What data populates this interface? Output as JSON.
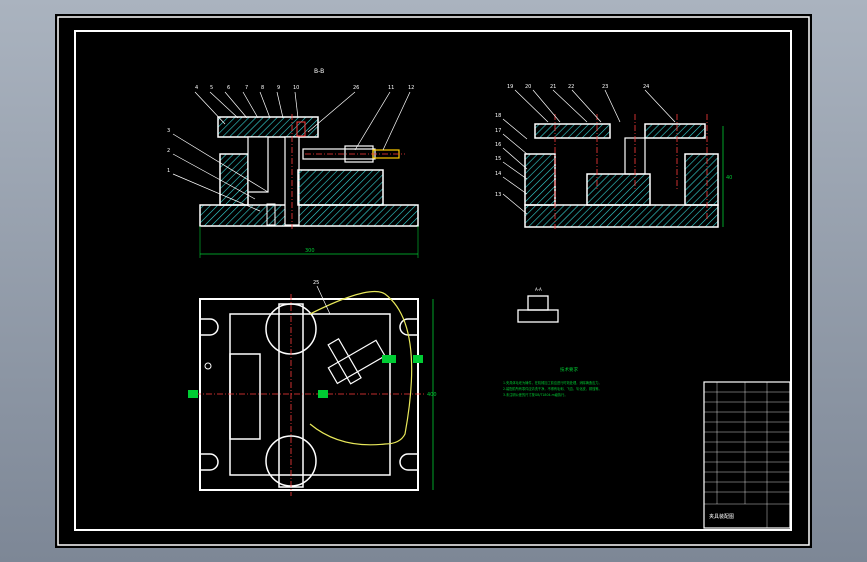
{
  "drawing": {
    "section_label": "B-B",
    "dims": {
      "base_width": "300",
      "height_right": "40",
      "plan_height": "400"
    },
    "front_view_callouts": [
      "4",
      "5",
      "6",
      "7",
      "8",
      "9",
      "10",
      "26",
      "11",
      "12",
      "3",
      "2",
      "1"
    ],
    "side_view_callouts": [
      "19",
      "20",
      "21",
      "22",
      "23",
      "24",
      "18",
      "17",
      "16",
      "15",
      "14",
      "13"
    ],
    "plan_callout": "25",
    "detail_label": "A-A",
    "tech_req_title": "技术要求",
    "tech_req_lines": [
      "1.夹具体毛坯为铸件，在机械加工前应进行时效处理，消除铸造应力。",
      "2.装配前所有零件应清洗干净，不得有毛刺、飞边、氧化皮、锈蚀等。",
      "3.未注明公差的尺寸按GB/T1804-m级执行。"
    ],
    "colors": {
      "outline": "#ffffff",
      "hatch": "#37d6d6",
      "dimension": "#00cc33",
      "center": "#ff3b3b",
      "accent": "#e8e85a",
      "handle": "#ffcc00"
    }
  },
  "title_block": {
    "title": "夹具装配图"
  }
}
